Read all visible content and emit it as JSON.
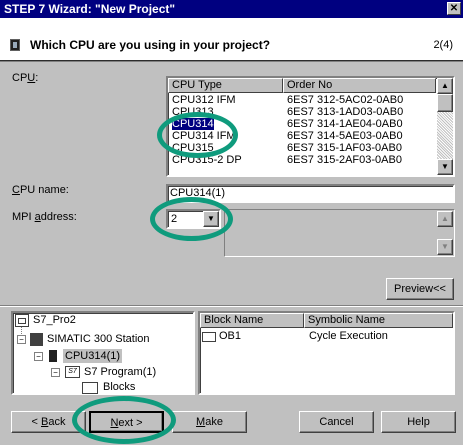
{
  "window": {
    "title": "STEP 7 Wizard: \"New Project\"",
    "close_glyph": "✕"
  },
  "header": {
    "question": "Which CPU are you using in your project?",
    "step": "2(4)"
  },
  "cpu_label": "CPU:",
  "cpu_table": {
    "columns": [
      "CPU Type",
      "Order No"
    ],
    "rows": [
      {
        "type": "CPU312 IFM",
        "order": "6ES7 312-5AC02-0AB0"
      },
      {
        "type": "CPU313",
        "order": "6ES7 313-1AD03-0AB0"
      },
      {
        "type": "CPU314",
        "order": "6ES7 314-1AE04-0AB0"
      },
      {
        "type": "CPU314 IFM",
        "order": "6ES7 314-5AE03-0AB0"
      },
      {
        "type": "CPU315",
        "order": "6ES7 315-1AF03-0AB0"
      },
      {
        "type": "CPU315-2 DP",
        "order": "6ES7 315-2AF03-0AB0"
      }
    ],
    "selected": "CPU314"
  },
  "cpu_name": {
    "label": "CPU name:",
    "value": "CPU314(1)"
  },
  "mpi_address": {
    "label": "MPI address:",
    "value": "2"
  },
  "preview_button": "Preview<<",
  "tree": {
    "project": "S7_Pro2",
    "station": "SIMATIC 300 Station",
    "cpu": "CPU314(1)",
    "program": "S7 Program(1)",
    "program_icon": "S7",
    "blocks": "Blocks"
  },
  "blocks_table": {
    "columns": [
      "Block Name",
      "Symbolic Name"
    ],
    "rows": [
      {
        "name": "OB1",
        "symbolic": "Cycle Execution"
      }
    ]
  },
  "buttons": {
    "back": "< Back",
    "next": "Next >",
    "make": "Make",
    "cancel": "Cancel",
    "help": "Help"
  },
  "annotation_color": "#0f9b7d",
  "selection_color": "#000080"
}
